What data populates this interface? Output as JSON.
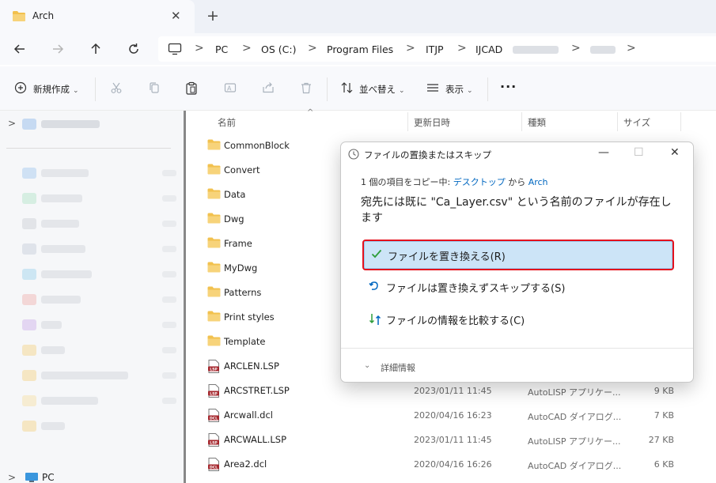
{
  "tab": {
    "title": "Arch",
    "close": "✕",
    "new": "+"
  },
  "address": {
    "crumbs": [
      "PC",
      "OS (C:)",
      "Program Files",
      "ITJP",
      "IJCAD"
    ],
    "sep": ">"
  },
  "toolbar": {
    "new_label": "新規作成",
    "sort_label": "並べ替え",
    "view_label": "表示",
    "more_label": "···",
    "caret": "⌄"
  },
  "columns": {
    "name": "名前",
    "date": "更新日時",
    "type": "種類",
    "size": "サイズ"
  },
  "files": [
    {
      "name": "CommonBlock",
      "kind": "folder",
      "date": "",
      "type": "",
      "size": ""
    },
    {
      "name": "Convert",
      "kind": "folder",
      "date": "",
      "type": "",
      "size": ""
    },
    {
      "name": "Data",
      "kind": "folder",
      "date": "",
      "type": "",
      "size": ""
    },
    {
      "name": "Dwg",
      "kind": "folder",
      "date": "",
      "type": "",
      "size": ""
    },
    {
      "name": "Frame",
      "kind": "folder",
      "date": "",
      "type": "",
      "size": ""
    },
    {
      "name": "MyDwg",
      "kind": "folder",
      "date": "",
      "type": "",
      "size": ""
    },
    {
      "name": "Patterns",
      "kind": "folder",
      "date": "",
      "type": "",
      "size": ""
    },
    {
      "name": "Print styles",
      "kind": "folder",
      "date": "",
      "type": "",
      "size": ""
    },
    {
      "name": "Template",
      "kind": "folder",
      "date": "",
      "type": "",
      "size": ""
    },
    {
      "name": "ARCLEN.LSP",
      "kind": "lsp",
      "date": "",
      "type": "",
      "size": ""
    },
    {
      "name": "ARCSTRET.LSP",
      "kind": "lsp",
      "date": "2023/01/11 11:45",
      "type": "AutoLISP アプリケー...",
      "size": "9 KB"
    },
    {
      "name": "Arcwall.dcl",
      "kind": "dcl",
      "date": "2020/04/16 16:23",
      "type": "AutoCAD ダイアログ...",
      "size": "7 KB"
    },
    {
      "name": "ARCWALL.LSP",
      "kind": "lsp",
      "date": "2023/01/11 11:45",
      "type": "AutoLISP アプリケー...",
      "size": "27 KB"
    },
    {
      "name": "Area2.dcl",
      "kind": "dcl",
      "date": "2020/04/16 16:26",
      "type": "AutoCAD ダイアログ...",
      "size": "6 KB"
    }
  ],
  "file_badges": {
    "lsp": "LSP",
    "dcl": "DCL"
  },
  "navpane": {
    "pc_label": "PC",
    "expand": ">"
  },
  "dialog": {
    "title": "ファイルの置換またはスキップ",
    "minimize": "—",
    "maximize": "☐",
    "close": "✕",
    "sub_prefix": "1 個の項目をコピー中: ",
    "sub_source": "デスクトップ",
    "sub_mid": " から ",
    "sub_dest": "Arch",
    "message": "宛先には既に \"Ca_Layer.csv\" という名前のファイルが存在します",
    "options": [
      {
        "label": "ファイルを置き換える(R)",
        "icon": "check-icon"
      },
      {
        "label": "ファイルは置き換えずスキップする(S)",
        "icon": "skip-arrow-icon"
      },
      {
        "label": "ファイルの情報を比較する(C)",
        "icon": "compare-icon"
      }
    ],
    "details_label": "詳細情報",
    "details_icon": "⌄"
  },
  "colors": {
    "accent": "#0067c0",
    "selected_bg": "#cce4f7",
    "highlight_border": "#e5111c",
    "folder": "#f2c14e",
    "file_badge": "#a4262c"
  }
}
